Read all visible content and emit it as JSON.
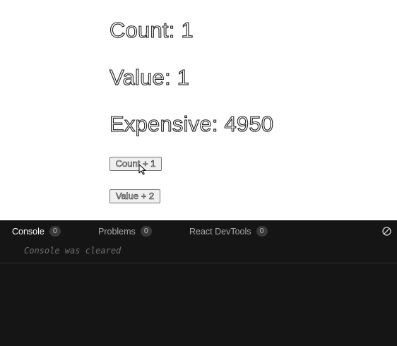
{
  "preview": {
    "count_heading": "Count: 1",
    "value_heading": "Value: 1",
    "expensive_heading": "Expensive: 4950",
    "count_button_label": "Count + 1",
    "value_button_label": "Value + 2"
  },
  "console_panel": {
    "tabs": [
      {
        "label": "Console",
        "count": "0",
        "active": true
      },
      {
        "label": "Problems",
        "count": "0",
        "active": false
      },
      {
        "label": "React DevTools",
        "count": "0",
        "active": false
      }
    ],
    "clear_icon": "clear-console-icon",
    "message": "Console was cleared"
  },
  "colors": {
    "console_background": "#151515",
    "active_tab_text": "#ffffff",
    "inactive_tab_text": "#a9a9a9",
    "badge_background": "#3a3a3a"
  }
}
